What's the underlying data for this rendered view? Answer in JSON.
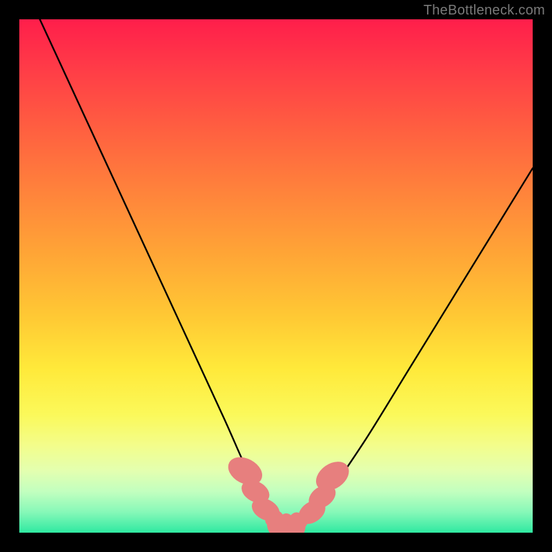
{
  "watermark": "TheBottleneck.com",
  "chart_data": {
    "type": "line",
    "title": "",
    "xlabel": "",
    "ylabel": "",
    "xlim": [
      0,
      100
    ],
    "ylim": [
      0,
      100
    ],
    "grid": false,
    "series": [
      {
        "name": "bottleneck-curve",
        "color": "#000000",
        "x": [
          4,
          10,
          16,
          22,
          28,
          34,
          40,
          44,
          48,
          50,
          52,
          54,
          56,
          58,
          62,
          68,
          76,
          84,
          92,
          100
        ],
        "y": [
          100,
          87,
          74,
          61,
          48,
          35,
          22,
          13,
          5,
          2,
          1,
          1,
          2,
          4,
          10,
          19,
          32,
          45,
          58,
          71
        ]
      }
    ],
    "markers": [
      {
        "name": "left-marker-upper",
        "x": 44.0,
        "y": 12.0,
        "r": 2.2,
        "color": "#e77f7e"
      },
      {
        "name": "left-marker-mid",
        "x": 46.0,
        "y": 8.0,
        "r": 1.8,
        "color": "#e77f7e"
      },
      {
        "name": "left-marker-lower",
        "x": 48.0,
        "y": 4.5,
        "r": 1.8,
        "color": "#e77f7e"
      },
      {
        "name": "valley-marker-1",
        "x": 50.0,
        "y": 1.8,
        "r": 1.6,
        "color": "#e77f7e"
      },
      {
        "name": "valley-marker-2",
        "x": 52.0,
        "y": 1.2,
        "r": 1.6,
        "color": "#e77f7e"
      },
      {
        "name": "valley-marker-3",
        "x": 54.0,
        "y": 1.4,
        "r": 1.6,
        "color": "#e77f7e"
      },
      {
        "name": "right-marker-lower",
        "x": 57.0,
        "y": 4.0,
        "r": 1.8,
        "color": "#e77f7e"
      },
      {
        "name": "right-marker-mid",
        "x": 59.0,
        "y": 7.0,
        "r": 1.8,
        "color": "#e77f7e"
      },
      {
        "name": "right-marker-upper",
        "x": 61.0,
        "y": 11.0,
        "r": 2.2,
        "color": "#e77f7e"
      }
    ],
    "valley_band": {
      "name": "valley-band",
      "color": "#e77f7e",
      "points_x": [
        49,
        50,
        51,
        52,
        53,
        54,
        55
      ],
      "points_y": [
        2.4,
        1.7,
        1.2,
        1.0,
        1.1,
        1.4,
        2.0
      ],
      "thickness": 2.2
    }
  }
}
